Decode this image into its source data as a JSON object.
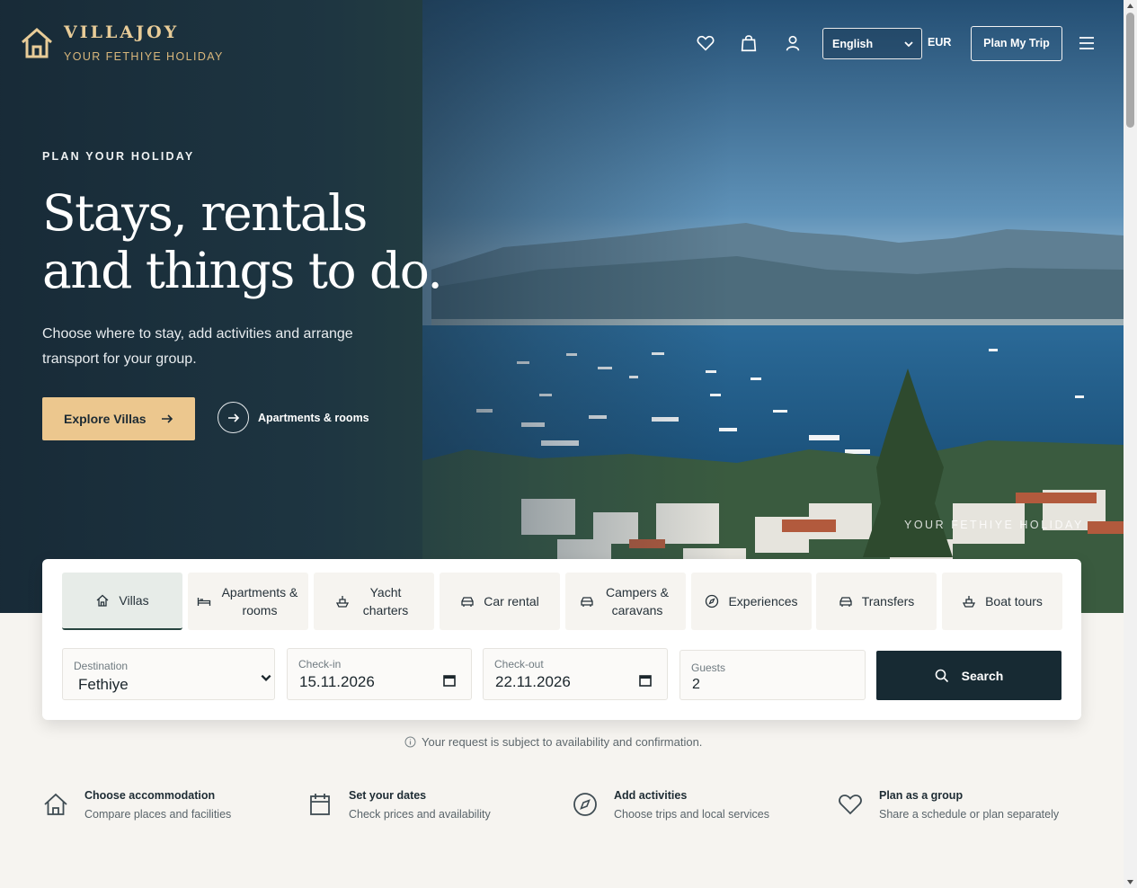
{
  "header": {
    "brand_name": "VILLAJOY",
    "brand_tagline": "YOUR FETHIYE HOLIDAY",
    "language": "English",
    "currency": "EUR",
    "plan_button": "Plan My Trip"
  },
  "hero": {
    "eyebrow": "PLAN YOUR HOLIDAY",
    "headline_line1": "Stays, rentals",
    "headline_line2": "and things to do.",
    "subtext": "Choose where to stay, add activities and arrange transport for your group.",
    "primary_button": "Explore Villas",
    "secondary_link": "Apartments & rooms",
    "watermark": "YOUR FETHIYE HOLIDAY"
  },
  "search": {
    "tabs": [
      {
        "label": "Villas",
        "icon": "home-icon"
      },
      {
        "label": "Apartments & rooms",
        "icon": "bed-icon"
      },
      {
        "label": "Yacht charters",
        "icon": "boat-icon"
      },
      {
        "label": "Car rental",
        "icon": "car-icon"
      },
      {
        "label": "Campers & caravans",
        "icon": "camper-icon"
      },
      {
        "label": "Experiences",
        "icon": "compass-icon"
      },
      {
        "label": "Transfers",
        "icon": "car-icon"
      },
      {
        "label": "Boat tours",
        "icon": "boat-icon"
      }
    ],
    "active_tab": "Villas",
    "destination_label": "Destination",
    "destination_value": "Fethiye",
    "checkin_label": "Check-in",
    "checkin_value": "15.11.2026",
    "checkout_label": "Check-out",
    "checkout_value": "22.11.2026",
    "guests_label": "Guests",
    "guests_value": "2",
    "search_button": "Search"
  },
  "notice": "Your request is subject to availability and confirmation.",
  "features": [
    {
      "title": "Choose accommodation",
      "desc": "Compare places and facilities",
      "icon": "home-icon"
    },
    {
      "title": "Set your dates",
      "desc": "Check prices and availability",
      "icon": "calendar-icon"
    },
    {
      "title": "Add activities",
      "desc": "Choose trips and local services",
      "icon": "compass-icon"
    },
    {
      "title": "Plan as a group",
      "desc": "Share a schedule or plan separately",
      "icon": "heart-icon"
    }
  ],
  "colors": {
    "accent": "#ECC78E",
    "brand_gold": "#E8CC98",
    "dark": "#172A33",
    "active_tab": "#E7ECE8"
  }
}
